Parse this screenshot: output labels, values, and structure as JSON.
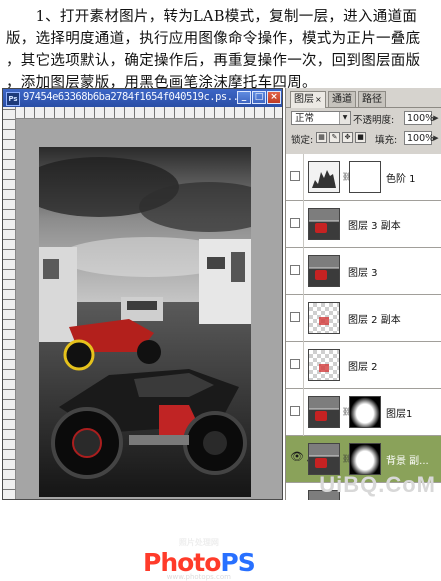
{
  "instructions": {
    "line1": "　　1、打开素材图片，转为LAB模式，复制一层，进入通道面",
    "line2": "版，选择明度通道，执行应用图像命令操作，模式为正片一叠底",
    "line3": "，其它选项默认，确定操作后，再重复操作一次，回到图层面版",
    "line4": "，添加图层蒙版，用黑色画笔涂沫摩托车四周。"
  },
  "document": {
    "title": "97454e63368b6ba2784f1654f040519c.ps...",
    "icon": "ps-icon",
    "controls": {
      "minimize": "_",
      "maximize": "□",
      "close": "×"
    },
    "watermark": {
      "tag": "照片处理网",
      "logo_a": "Photo",
      "logo_b": "PS",
      "url": "www.photops.com"
    }
  },
  "layers_panel": {
    "tabs": [
      {
        "label": "图层",
        "close": "×",
        "active": true
      },
      {
        "label": "通道",
        "active": false
      },
      {
        "label": "路径",
        "active": false
      }
    ],
    "blend_mode": "正常",
    "opacity_label": "不透明度:",
    "opacity_value": "100%",
    "lock_label": "锁定:",
    "fill_label": "填充:",
    "fill_value": "100%",
    "layers": [
      {
        "name": "色阶 1",
        "visible": false,
        "selected": false
      },
      {
        "name": "图层 3 副本",
        "visible": false,
        "selected": false
      },
      {
        "name": "图层 3",
        "visible": false,
        "selected": false
      },
      {
        "name": "图层 2 副本",
        "visible": false,
        "selected": false
      },
      {
        "name": "图层 2",
        "visible": false,
        "selected": false
      },
      {
        "name": "图层1",
        "visible": false,
        "selected": false
      },
      {
        "name": "背景 副...",
        "visible": true,
        "selected": true
      }
    ]
  },
  "site_watermark": {
    "text": "UiBQ.CoM"
  }
}
